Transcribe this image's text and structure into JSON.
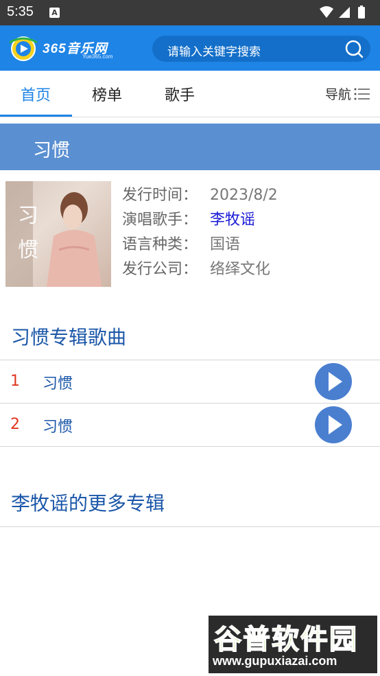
{
  "status_bar": {
    "time": "5:35",
    "notification_icon": "A"
  },
  "header": {
    "logo_text": "365音乐网",
    "logo_sub": "Yue365.com",
    "search_placeholder": "请输入关键字搜索"
  },
  "tabs": [
    {
      "label": "首页",
      "active": true
    },
    {
      "label": "榜单",
      "active": false
    },
    {
      "label": "歌手",
      "active": false
    }
  ],
  "nav_label": "导航",
  "album": {
    "title": "习惯",
    "cover_text": "习惯",
    "info": [
      {
        "label": "发行时间：",
        "value": "2023/8/2"
      },
      {
        "label": "演唱歌手：",
        "value": "李牧谣"
      },
      {
        "label": "语言种类：",
        "value": "国语"
      },
      {
        "label": "发行公司：",
        "value": "络绎文化"
      }
    ]
  },
  "songs_section_title": "习惯专辑歌曲",
  "songs": [
    {
      "num": "1",
      "name": "习惯"
    },
    {
      "num": "2",
      "name": "习惯"
    }
  ],
  "more_section_title": "李牧谣的更多专辑",
  "watermark": {
    "big": "谷普软件园",
    "small": "www.gupuxiazai.com"
  },
  "colors": {
    "brand_blue": "#1e84e6",
    "title_bar": "#5a8fd1",
    "link": "#1a1ad6",
    "song_num": "#e0361e",
    "play": "#4a7fd0"
  }
}
